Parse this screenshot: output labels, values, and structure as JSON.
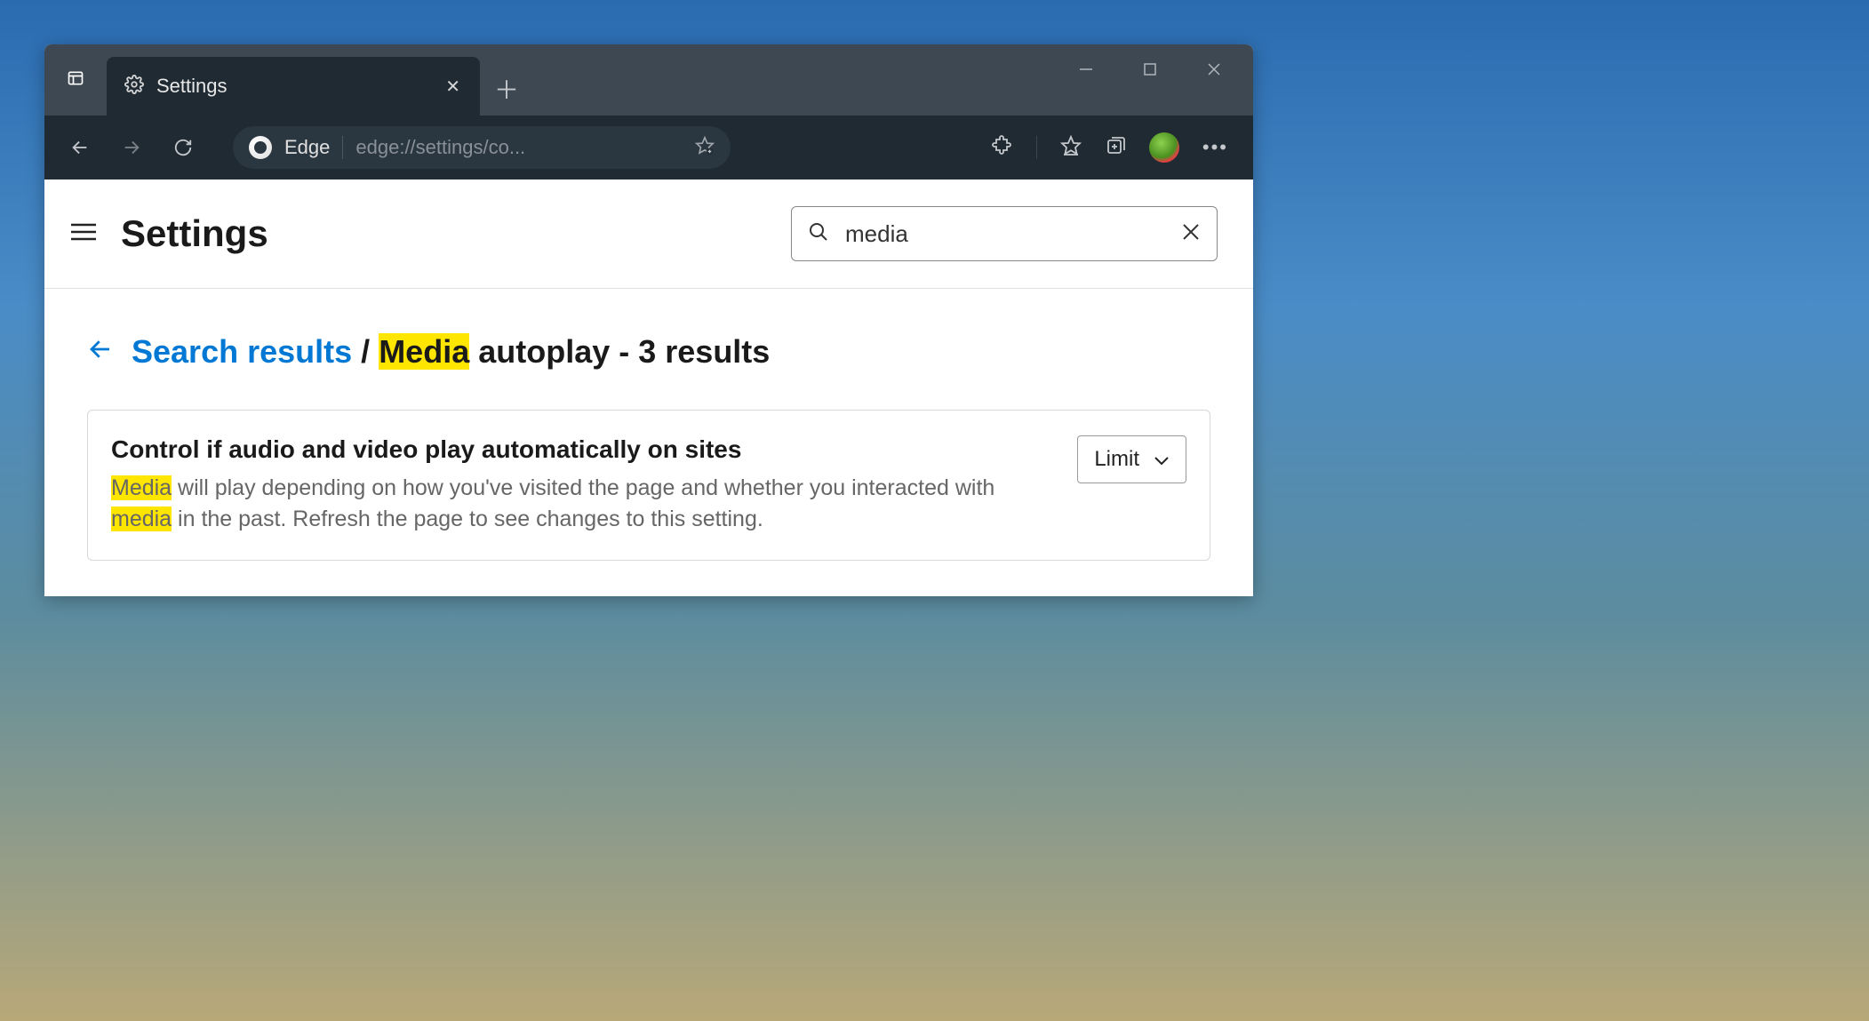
{
  "tab": {
    "title": "Settings"
  },
  "toolbar": {
    "edge_label": "Edge",
    "url": "edge://settings/co..."
  },
  "header": {
    "title": "Settings",
    "search_value": "media"
  },
  "breadcrumb": {
    "link": "Search results",
    "sep": "/",
    "highlight": "Media",
    "rest": " autoplay - 3 results"
  },
  "result": {
    "title": "Control if audio and video play automatically on sites",
    "desc_hl1": "Media",
    "desc_mid": " will play depending on how you've visited the page and whether you interacted with ",
    "desc_hl2": "media",
    "desc_end": " in the past. Refresh the page to see changes to this setting.",
    "dropdown_value": "Limit"
  }
}
